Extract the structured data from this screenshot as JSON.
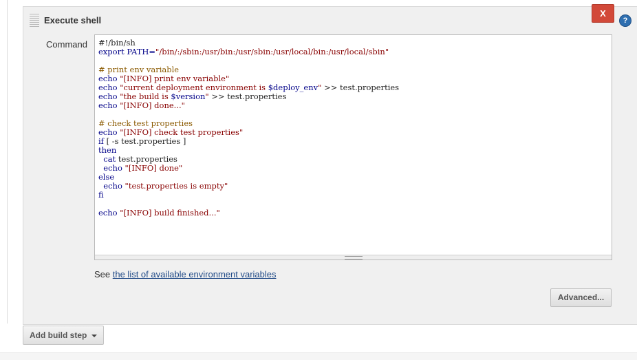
{
  "section": {
    "title": "Execute shell",
    "close_label": "X",
    "help_label": "?"
  },
  "command": {
    "label": "Command",
    "lines": [
      [
        {
          "t": "#!/bin/sh",
          "c": ""
        }
      ],
      [
        {
          "t": "export PATH=",
          "c": "kw"
        },
        {
          "t": "\"/bin/:/sbin:/usr/bin:/usr/sbin:/usr/local/bin:/usr/local/sbin\"",
          "c": "str"
        }
      ],
      [
        {
          "t": "",
          "c": ""
        }
      ],
      [
        {
          "t": "# print env variable",
          "c": "cm"
        }
      ],
      [
        {
          "t": "echo ",
          "c": "kw"
        },
        {
          "t": "\"[INFO] print env variable\"",
          "c": "str"
        }
      ],
      [
        {
          "t": "echo ",
          "c": "kw"
        },
        {
          "t": "\"current deployment environment is ",
          "c": "str"
        },
        {
          "t": "$deploy_env",
          "c": "var"
        },
        {
          "t": "\"",
          "c": "str"
        },
        {
          "t": " >> test.properties",
          "c": ""
        }
      ],
      [
        {
          "t": "echo ",
          "c": "kw"
        },
        {
          "t": "\"the build is ",
          "c": "str"
        },
        {
          "t": "$version",
          "c": "var"
        },
        {
          "t": "\"",
          "c": "str"
        },
        {
          "t": " >> test.properties",
          "c": ""
        }
      ],
      [
        {
          "t": "echo ",
          "c": "kw"
        },
        {
          "t": "\"[INFO] done...\"",
          "c": "str"
        }
      ],
      [
        {
          "t": "",
          "c": ""
        }
      ],
      [
        {
          "t": "# check test properties",
          "c": "cm"
        }
      ],
      [
        {
          "t": "echo ",
          "c": "kw"
        },
        {
          "t": "\"[INFO] check test properties\"",
          "c": "str"
        }
      ],
      [
        {
          "t": "if",
          "c": "kw"
        },
        {
          "t": " [ -s test.properties ]",
          "c": ""
        }
      ],
      [
        {
          "t": "then",
          "c": "kw"
        }
      ],
      [
        {
          "t": "  cat",
          "c": "kw"
        },
        {
          "t": " test.properties",
          "c": ""
        }
      ],
      [
        {
          "t": "  echo ",
          "c": "kw"
        },
        {
          "t": "\"[INFO] done\"",
          "c": "str"
        }
      ],
      [
        {
          "t": "else",
          "c": "kw"
        }
      ],
      [
        {
          "t": "  echo ",
          "c": "kw"
        },
        {
          "t": "\"test.properties is empty\"",
          "c": "str"
        }
      ],
      [
        {
          "t": "fi",
          "c": "kw"
        }
      ],
      [
        {
          "t": "",
          "c": ""
        }
      ],
      [
        {
          "t": "echo ",
          "c": "kw"
        },
        {
          "t": "\"[INFO] build finished...\"",
          "c": "str"
        }
      ]
    ]
  },
  "env_help": {
    "prefix": "See ",
    "link_text": "the list of available environment variables"
  },
  "buttons": {
    "advanced": "Advanced...",
    "add_build_step": "Add build step"
  }
}
